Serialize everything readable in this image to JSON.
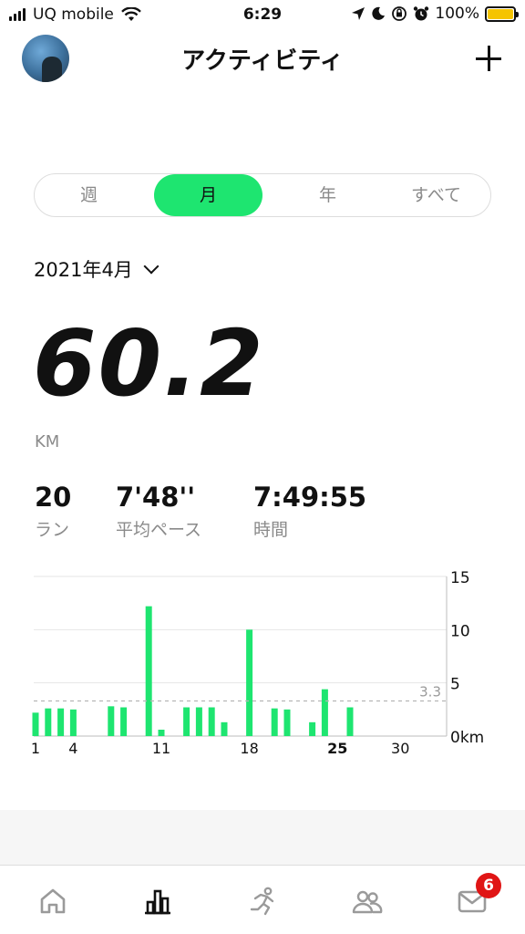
{
  "status_bar": {
    "carrier": "UQ mobile",
    "time": "6:29",
    "battery": "100%"
  },
  "header": {
    "title": "アクティビティ"
  },
  "segments": [
    "週",
    "月",
    "年",
    "すべて"
  ],
  "selected_segment": "月",
  "period": {
    "label": "2021年4月"
  },
  "summary": {
    "distance": "60.2",
    "unit": "KM"
  },
  "stats": [
    {
      "value": "20",
      "label": "ラン"
    },
    {
      "value": "7'48''",
      "label": "平均ペース"
    },
    {
      "value": "7:49:55",
      "label": "時間"
    }
  ],
  "chart_data": {
    "type": "bar",
    "x_ticks": [
      1,
      4,
      11,
      18,
      25,
      30
    ],
    "bold_tick": 25,
    "y_ticks": [
      "15",
      "10",
      "5",
      "0km"
    ],
    "ylim": [
      0,
      15
    ],
    "average": 3.3,
    "average_label": "3.3",
    "bars": [
      {
        "day": 1,
        "value": 2.2
      },
      {
        "day": 2,
        "value": 2.6
      },
      {
        "day": 3,
        "value": 2.6
      },
      {
        "day": 4,
        "value": 2.5
      },
      {
        "day": 7,
        "value": 2.8
      },
      {
        "day": 8,
        "value": 2.7
      },
      {
        "day": 10,
        "value": 12.2
      },
      {
        "day": 11,
        "value": 0.6
      },
      {
        "day": 13,
        "value": 2.7
      },
      {
        "day": 14,
        "value": 2.7
      },
      {
        "day": 15,
        "value": 2.7
      },
      {
        "day": 16,
        "value": 1.3
      },
      {
        "day": 18,
        "value": 10.0
      },
      {
        "day": 20,
        "value": 2.6
      },
      {
        "day": 21,
        "value": 2.5
      },
      {
        "day": 23,
        "value": 1.3
      },
      {
        "day": 24,
        "value": 4.4
      },
      {
        "day": 26,
        "value": 2.7
      }
    ],
    "bar_color": "#1ee570"
  },
  "tabbar": {
    "items": [
      "home-icon",
      "activity-chart-icon",
      "run-icon",
      "community-icon",
      "inbox-icon"
    ],
    "inbox_badge": "6"
  },
  "colors": {
    "accent": "#1ee570",
    "badge": "#e01515"
  }
}
